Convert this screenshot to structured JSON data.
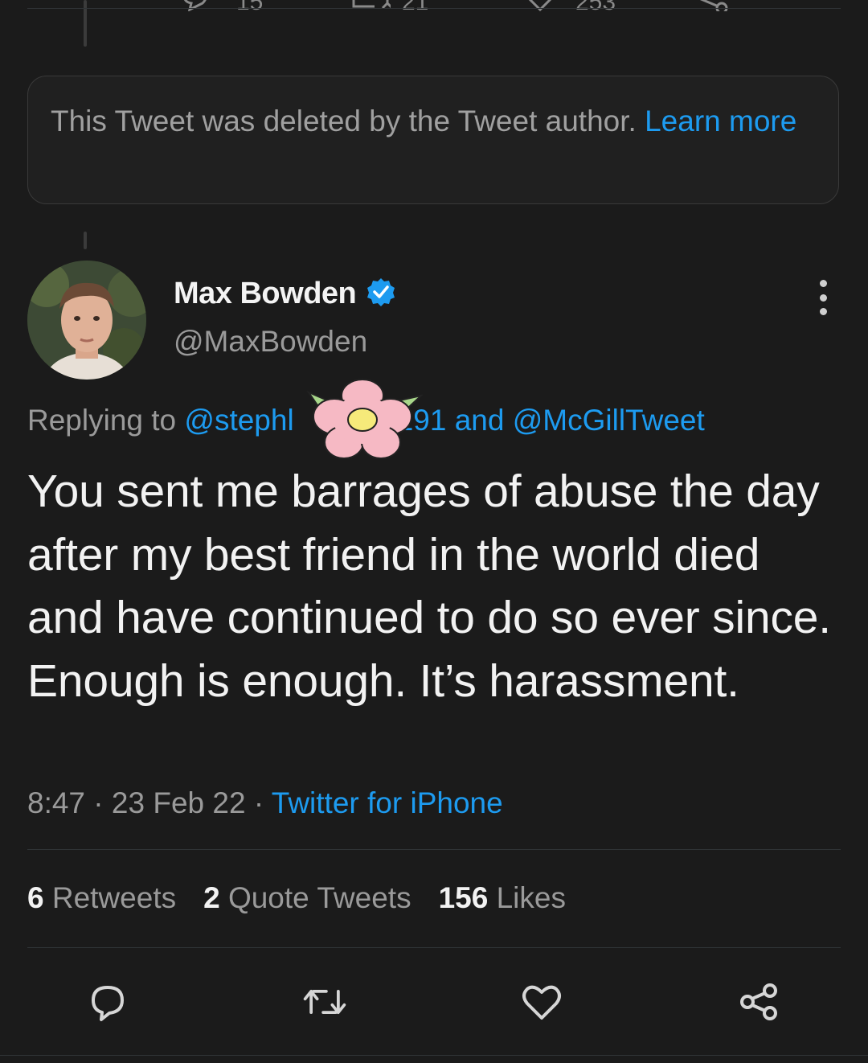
{
  "prev_tweet": {
    "counts": {
      "reply": "15",
      "retweet": "21",
      "like": "253"
    }
  },
  "deleted_notice": {
    "text": "This Tweet was deleted by the Tweet author.",
    "link_label": "Learn more"
  },
  "tweet": {
    "author": {
      "name": "Max Bowden",
      "handle": "@MaxBowden",
      "verified": true
    },
    "reply_prefix": "Replying to",
    "reply_handle_1_start": "@stephl",
    "reply_handle_1_end": "191",
    "reply_and": "and",
    "reply_handle_2": "@McGillTweet",
    "text": "You sent me barrages of abuse the day after my best friend in the world died and have continued to do so ever since. Enough is enough. It’s harassment.",
    "time": "8:47",
    "date": "23 Feb 22",
    "source": "Twitter for iPhone",
    "stats": {
      "retweets_count": "6",
      "retweets_label": "Retweets",
      "quotes_count": "2",
      "quotes_label": "Quote Tweets",
      "likes_count": "156",
      "likes_label": "Likes"
    }
  },
  "colors": {
    "background": "#1b1b1b",
    "link": "#1d9bf0",
    "secondary_text": "#9a9a9a",
    "primary_text": "#f2f2f2"
  },
  "icons": [
    "reply-icon",
    "retweet-icon",
    "like-icon",
    "share-icon",
    "verified-badge-icon",
    "more-icon",
    "flower-sticker"
  ]
}
